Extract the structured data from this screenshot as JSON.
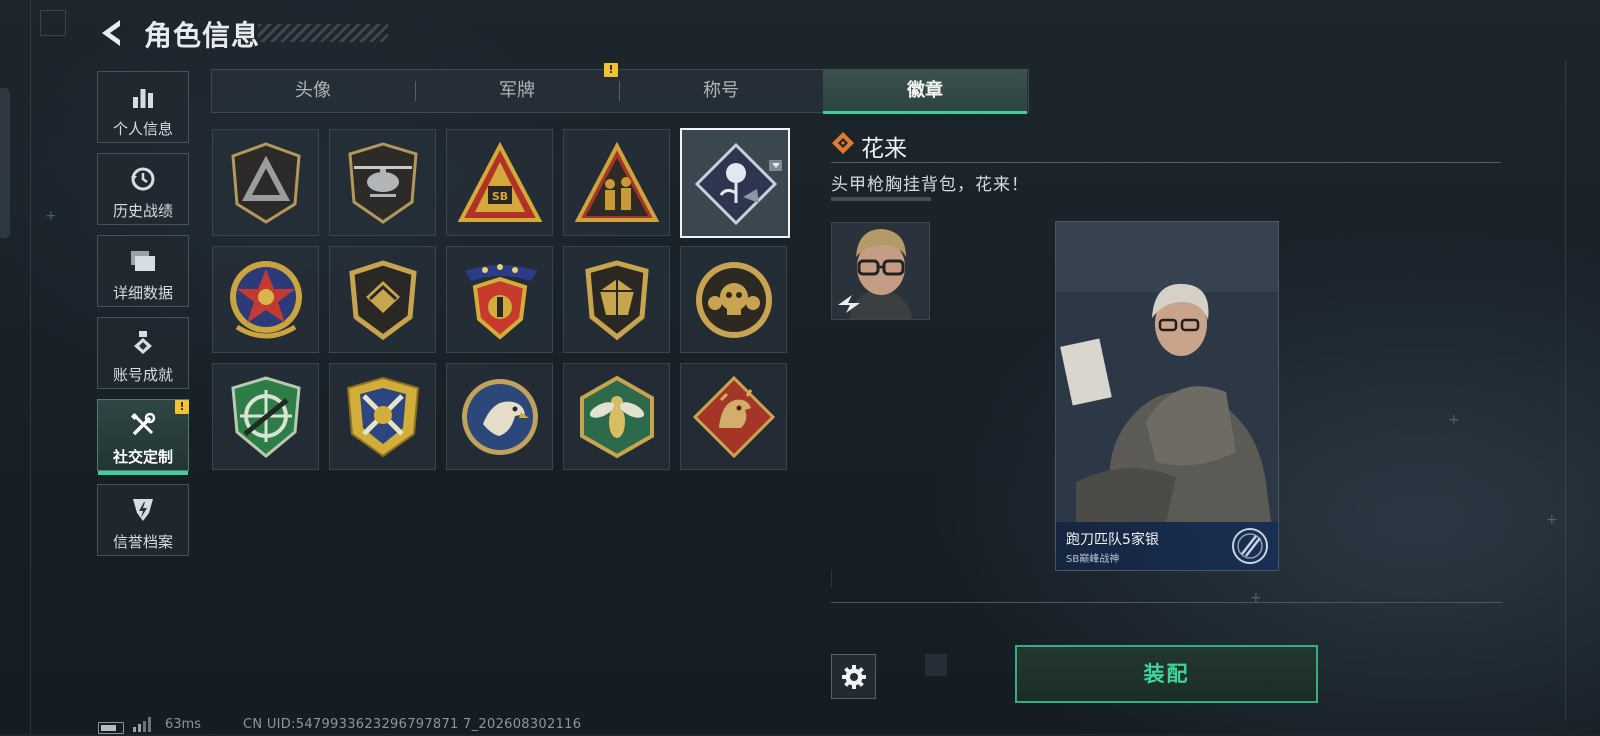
{
  "header": {
    "title": "角色信息"
  },
  "sidebar": {
    "items": [
      {
        "label": "个人信息",
        "icon": "bar-chart-icon"
      },
      {
        "label": "历史战绩",
        "icon": "history-clock-icon"
      },
      {
        "label": "详细数据",
        "icon": "folder-stack-icon"
      },
      {
        "label": "账号成就",
        "icon": "achievement-medal-icon"
      },
      {
        "label": "社交定制",
        "icon": "wrench-screwdriver-icon",
        "active": true,
        "alert": "!"
      },
      {
        "label": "信誉档案",
        "icon": "credit-shield-icon"
      }
    ]
  },
  "tabs": [
    {
      "label": "头像"
    },
    {
      "label": "军牌",
      "alert": "!"
    },
    {
      "label": "称号"
    },
    {
      "label": "徽章",
      "active": true
    }
  ],
  "badges": [
    {
      "icon": "triangle-shield-badge-icon",
      "color": "#8a8f94"
    },
    {
      "icon": "helicopter-shield-badge-icon",
      "color": "#a7a9ad"
    },
    {
      "icon": "sb-triangle-badge-icon",
      "color": "#d2a73d",
      "text": "SB"
    },
    {
      "icon": "soldiers-triangle-badge-icon",
      "color": "#c99b36"
    },
    {
      "icon": "rose-diamond-badge-icon",
      "color": "#b9c4d8",
      "selected": true
    },
    {
      "icon": "star-wreath-badge-icon",
      "color": "#c43a32"
    },
    {
      "icon": "wing-shield-badge-icon",
      "color": "#c7a44e"
    },
    {
      "icon": "stars-emblem-badge-icon",
      "color": "#c63b2c"
    },
    {
      "icon": "gem-shield-badge-icon",
      "color": "#c7a44e"
    },
    {
      "icon": "skull-circle-badge-icon",
      "color": "#c8a452"
    },
    {
      "icon": "rifle-crosshair-badge-icon",
      "color": "#2e7d46"
    },
    {
      "icon": "crossed-swords-badge-icon",
      "color": "#d3ad39"
    },
    {
      "icon": "eagle-circle-badge-icon",
      "color": "#2c4779"
    },
    {
      "icon": "wasp-hexagon-badge-icon",
      "color": "#2d6a4c"
    },
    {
      "icon": "dragon-diamond-badge-icon",
      "color": "#a43628"
    }
  ],
  "detail": {
    "name": "花来",
    "description": "头甲枪胸挂背包，花来！",
    "card": {
      "title": "跑刀匹队5家银",
      "subtitle": "SB巅峰战神"
    }
  },
  "actions": {
    "equip_label": "装配"
  },
  "status": {
    "ping": "63ms",
    "uid": "CN UID:5479933623296797871 7_202608302116"
  },
  "colors": {
    "accent": "#3fcf9a",
    "alert": "#f2c431",
    "equip_text": "#3fd596"
  }
}
